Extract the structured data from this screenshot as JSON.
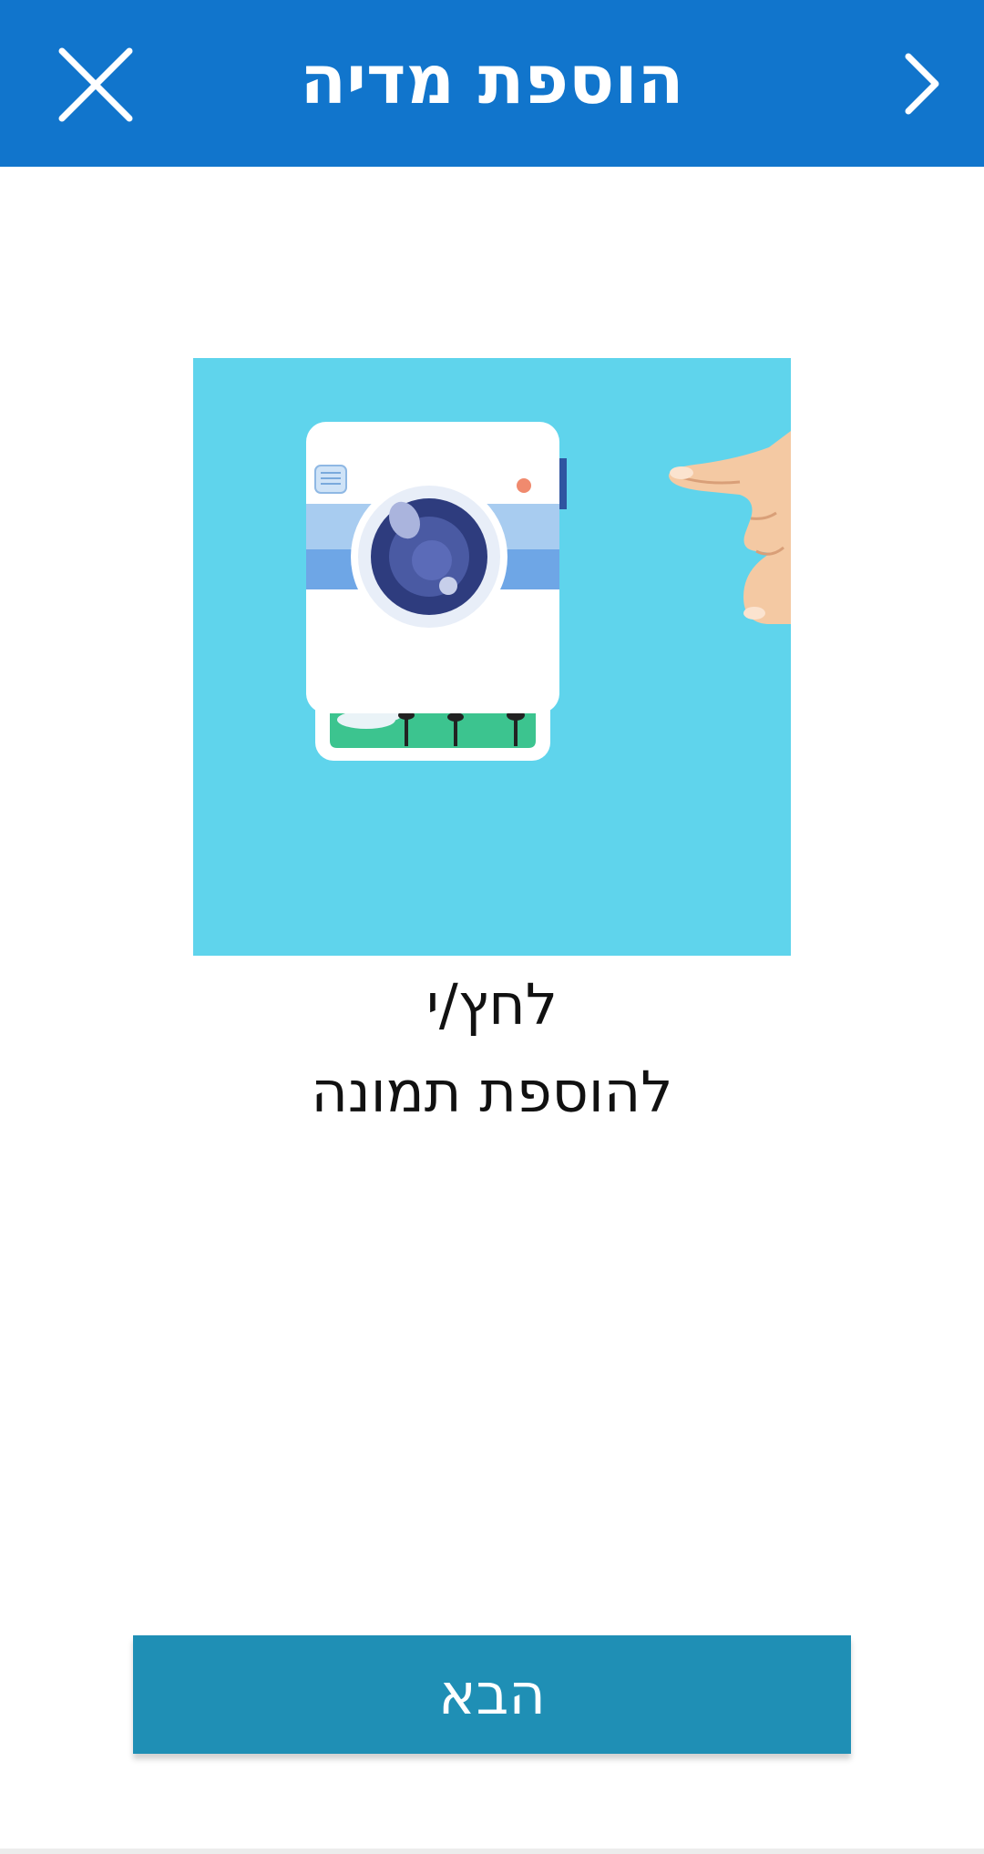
{
  "header": {
    "title": "הוספת מדיה",
    "close_icon": "close-icon",
    "back_icon": "chevron-right-icon",
    "background_color": "#1175cc"
  },
  "media": {
    "illustration": "camera-with-tapping-finger",
    "background_color": "#5fd4ec"
  },
  "instruction": {
    "line1": "לחץ/י",
    "line2": "להוספת תמונה"
  },
  "footer": {
    "next_label": "הבא",
    "button_color": "#1f8fb5"
  }
}
